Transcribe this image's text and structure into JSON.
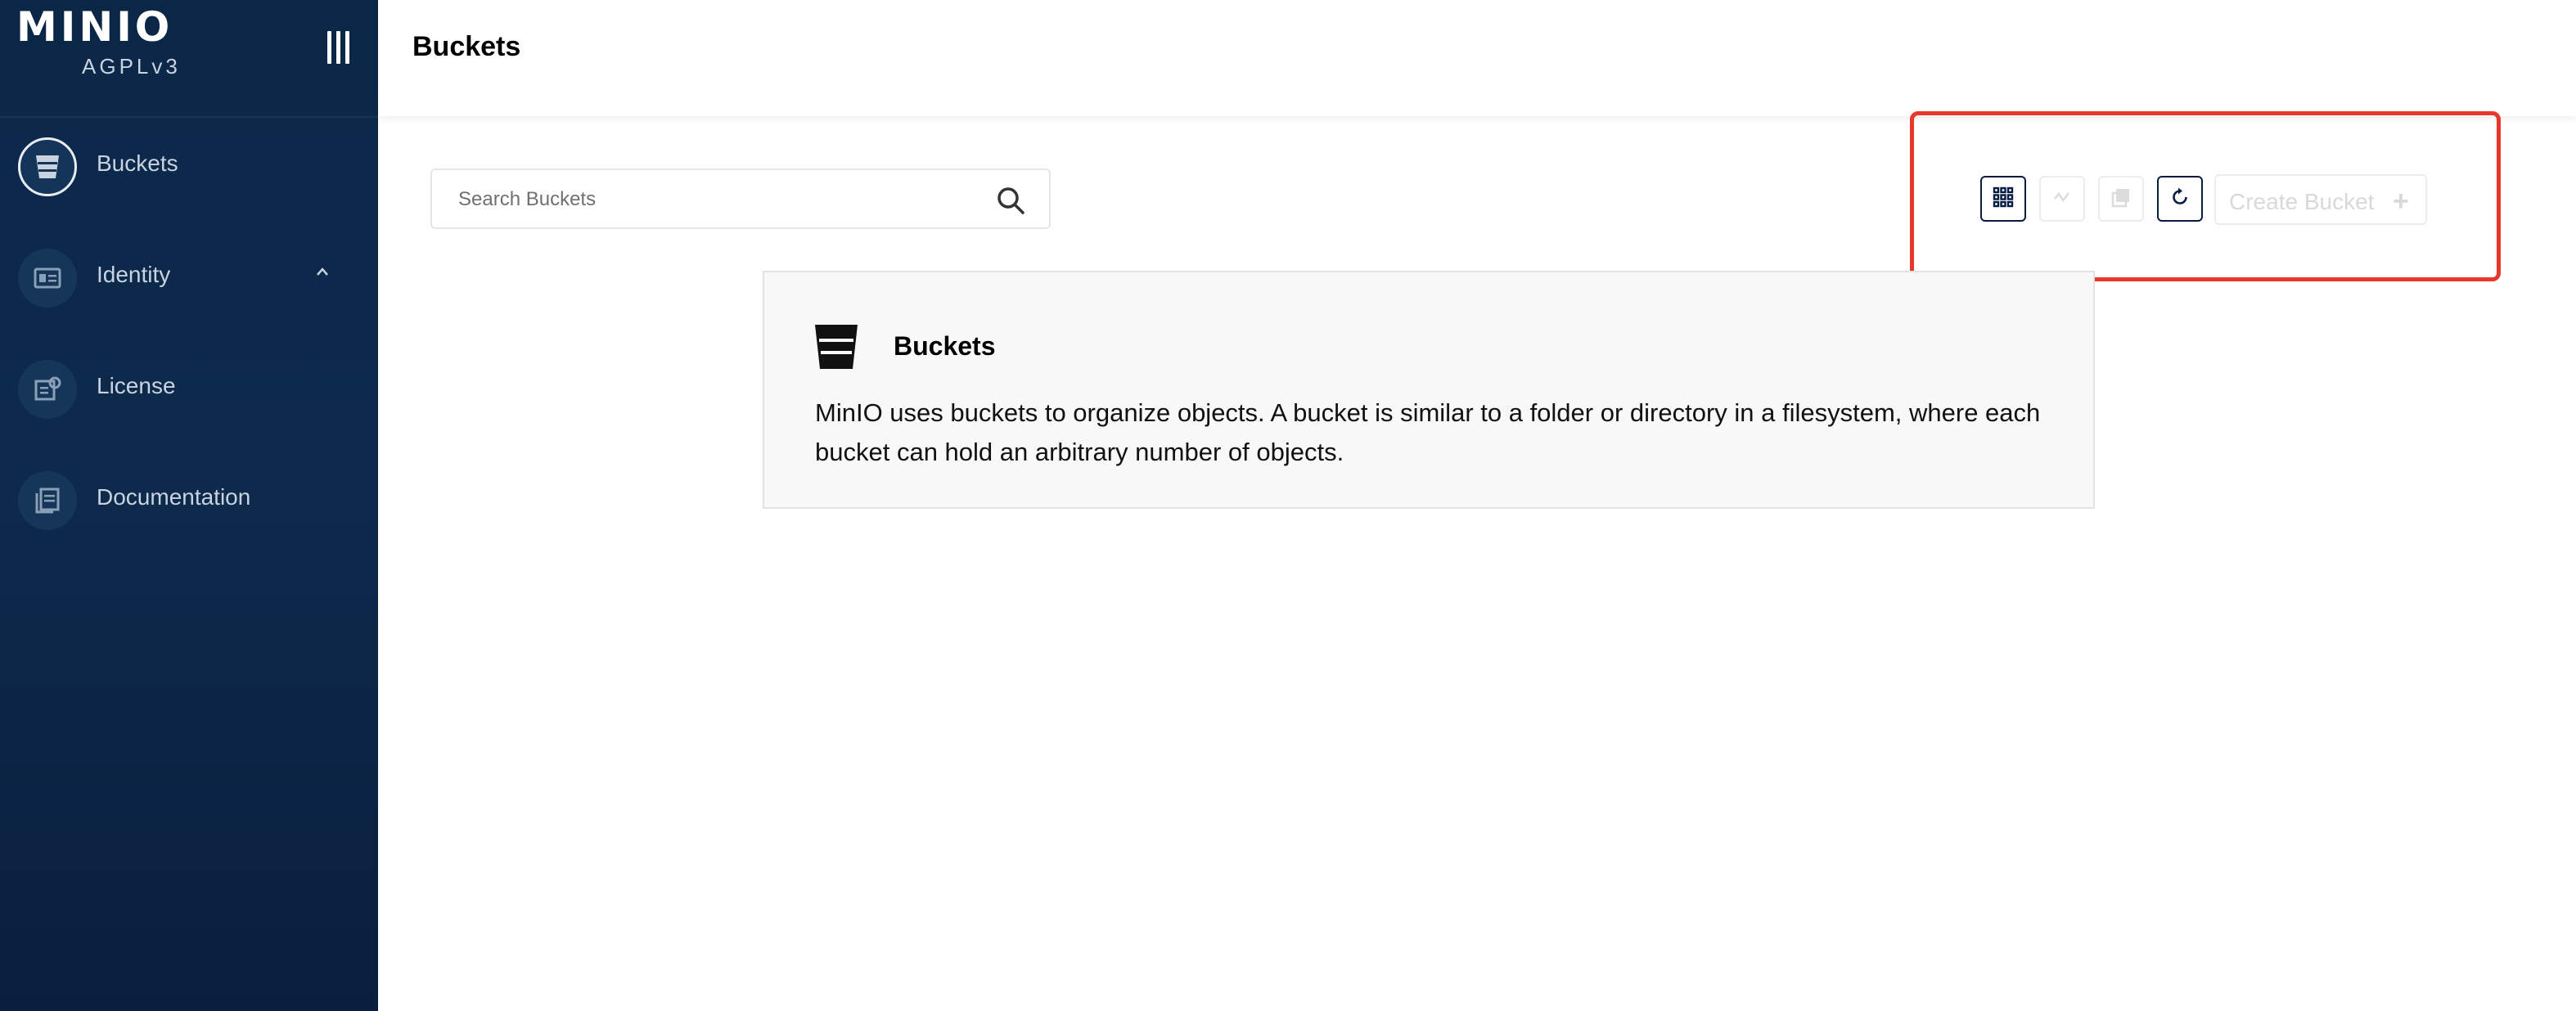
{
  "brand": {
    "name": "MINIO",
    "edition": "AGPLv3"
  },
  "sidebar": {
    "items": [
      {
        "label": "Buckets",
        "icon": "bucket-icon",
        "active": true
      },
      {
        "label": "Identity",
        "icon": "id-card-icon",
        "expanded": true
      },
      {
        "label": "License",
        "icon": "license-icon"
      },
      {
        "label": "Documentation",
        "icon": "documentation-icon"
      }
    ]
  },
  "header": {
    "title": "Buckets"
  },
  "search": {
    "placeholder": "Search Buckets",
    "value": ""
  },
  "toolbar": {
    "buttons": [
      {
        "icon": "grid-view-icon",
        "enabled": true
      },
      {
        "icon": "replication-icon",
        "enabled": false
      },
      {
        "icon": "lifecycle-icon",
        "enabled": false
      },
      {
        "icon": "refresh-icon",
        "enabled": true
      }
    ],
    "create_label": "Create Bucket",
    "create_enabled": false
  },
  "info": {
    "title": "Buckets",
    "text": "MinIO uses buckets to organize objects. A bucket is similar to a folder or directory in a filesystem, where each bucket can hold an arbitrary number of objects."
  },
  "colors": {
    "sidebar": "#0b2748",
    "highlight": "#e8382a",
    "primary_dark": "#081c42"
  }
}
